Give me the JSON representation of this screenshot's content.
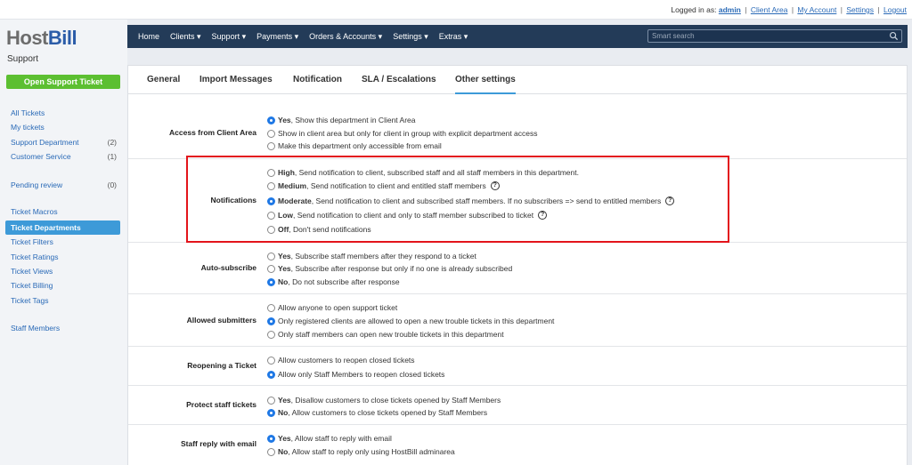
{
  "topbar": {
    "logged_in_label": "Logged in as:",
    "username": "admin",
    "links": [
      "Client Area",
      "My Account",
      "Settings",
      "Logout"
    ]
  },
  "brand": {
    "host": "Host",
    "bill": "Bill"
  },
  "sidebar": {
    "section_title": "Support",
    "open_ticket_label": "Open Support Ticket",
    "items": [
      {
        "label": "All Tickets",
        "count": ""
      },
      {
        "label": "My tickets",
        "count": ""
      },
      {
        "label": "Support Department",
        "count": "(2)"
      },
      {
        "label": "Customer Service",
        "count": "(1)"
      },
      {
        "label": "Pending review",
        "count": "(0)"
      },
      {
        "label": "Ticket Macros",
        "count": ""
      },
      {
        "label": "Ticket Departments",
        "count": "",
        "active": true
      },
      {
        "label": "Ticket Filters",
        "count": ""
      },
      {
        "label": "Ticket Ratings",
        "count": ""
      },
      {
        "label": "Ticket Views",
        "count": ""
      },
      {
        "label": "Ticket Billing",
        "count": ""
      },
      {
        "label": "Ticket Tags",
        "count": ""
      },
      {
        "label": "Staff Members",
        "count": ""
      }
    ]
  },
  "navbar": {
    "items": [
      "Home",
      "Clients ▾",
      "Support ▾",
      "Payments ▾",
      "Orders & Accounts ▾",
      "Settings ▾",
      "Extras ▾"
    ],
    "search_placeholder": "Smart search"
  },
  "tabs": [
    "General",
    "Import Messages",
    "Notification",
    "SLA / Escalations",
    "Other settings"
  ],
  "active_tab": "Other settings",
  "settings": [
    {
      "label": "Access from Client Area",
      "options": [
        {
          "bold": "Yes",
          "text": ", Show this department in Client Area",
          "checked": true
        },
        {
          "bold": "",
          "text": "Show in client area but only for client in group with explicit department access",
          "checked": false
        },
        {
          "bold": "",
          "text": "Make this department only accessible from email",
          "checked": false
        }
      ]
    },
    {
      "label": "Notifications",
      "options": [
        {
          "bold": "High",
          "text": ", Send notification to client, subscribed staff and all staff members in this department.",
          "checked": false,
          "help": false
        },
        {
          "bold": "Medium",
          "text": ", Send notification to client and entitled staff members",
          "checked": false,
          "help": true
        },
        {
          "bold": "Moderate",
          "text": ", Send notification to client and subscribed staff members. If no subscribers => send to entitled members",
          "checked": true,
          "help": true
        },
        {
          "bold": "Low",
          "text": ", Send notification to client and only to staff member subscribed to ticket",
          "checked": false,
          "help": true
        },
        {
          "bold": "Off",
          "text": ", Don't send notifications",
          "checked": false,
          "help": false
        }
      ]
    },
    {
      "label": "Auto-subscribe",
      "options": [
        {
          "bold": "Yes",
          "text": ", Subscribe staff members after they respond to a ticket",
          "checked": false
        },
        {
          "bold": "Yes",
          "text": ", Subscribe after response but only if no one is already subscribed",
          "checked": false
        },
        {
          "bold": "No",
          "text": ", Do not subscribe after response",
          "checked": true
        }
      ]
    },
    {
      "label": "Allowed submitters",
      "options": [
        {
          "bold": "",
          "text": "Allow anyone to open support ticket",
          "checked": false
        },
        {
          "bold": "",
          "text": "Only registered clients are allowed to open a new trouble tickets in this department",
          "checked": true
        },
        {
          "bold": "",
          "text": "Only staff members can open new trouble tickets in this department",
          "checked": false
        }
      ]
    },
    {
      "label": "Reopening a Ticket",
      "options": [
        {
          "bold": "",
          "text": "Allow customers to reopen closed tickets",
          "checked": false
        },
        {
          "bold": "",
          "text": "Allow only Staff Members to reopen closed tickets",
          "checked": true
        }
      ]
    },
    {
      "label": "Protect staff tickets",
      "options": [
        {
          "bold": "Yes",
          "text": ", Disallow customers to close tickets opened by Staff Members",
          "checked": false
        },
        {
          "bold": "No",
          "text": ", Allow customers to close tickets opened by Staff Members",
          "checked": true
        }
      ]
    },
    {
      "label": "Staff reply with email",
      "options": [
        {
          "bold": "Yes",
          "text": ", Allow staff to reply with email",
          "checked": true
        },
        {
          "bold": "No",
          "text": ", Allow staff to reply only using HostBill adminarea",
          "checked": false
        }
      ]
    }
  ]
}
